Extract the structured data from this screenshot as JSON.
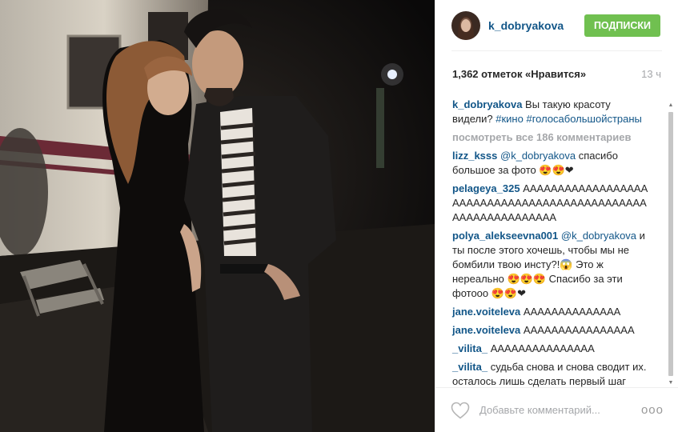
{
  "post": {
    "username": "k_dobryakova",
    "follow_label": "ПОДПИСКИ",
    "likes_text": "1,362 отметок «Нравится»",
    "time_ago": "13 ч"
  },
  "caption": {
    "user": "k_dobryakova",
    "text": " Вы такую красоту видели? ",
    "tag1": "#кино",
    "tag2": "#голосабольшойстраны"
  },
  "view_all": "посмотреть все 186 комментариев",
  "comments": [
    {
      "user": "lizz_ksss",
      "mention": "@k_dobryakova",
      "text": " спасибо большое за фото 😍😍❤"
    },
    {
      "user": "pelageya_325",
      "mention": "",
      "text": " ААААААААААААААААААААААААААААААААААААААААААААААААААААААААААААА"
    },
    {
      "user": "polya_alekseevna001",
      "mention": "@k_dobryakova",
      "text": " и ты после этого хочешь, чтобы мы не бомбили твою инсту?!😱 Это ж нереально 😍😍😍 Спасибо за эти фотооо 😍😍❤"
    },
    {
      "user": "jane.voiteleva",
      "mention": "",
      "text": " АААААААААААААА"
    },
    {
      "user": "jane.voiteleva",
      "mention": "",
      "text": " АААААААААААААААА"
    },
    {
      "user": "_vilita_",
      "mention": "",
      "text": " ААААААААААААААА"
    },
    {
      "user": "_vilita_",
      "mention": "",
      "text": " судьба снова и снова сводит их. осталось лишь сделать первый шаг"
    }
  ],
  "footer": {
    "placeholder": "Добавьте комментарий...",
    "more_label": "ооо"
  },
  "colors": {
    "username": "#125688",
    "follow_green": "#70c050",
    "muted": "#a5a7aa"
  }
}
